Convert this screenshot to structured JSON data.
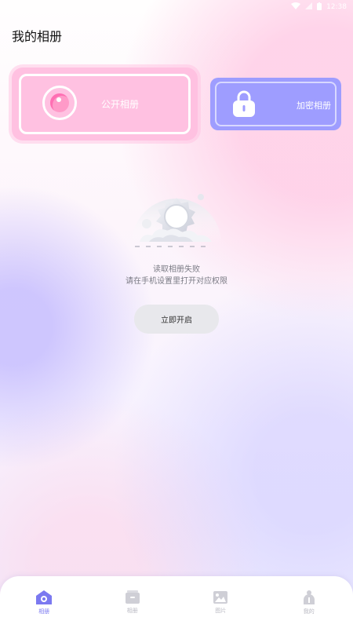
{
  "status_bar": {
    "time": "12:38",
    "icons": [
      "wifi-icon",
      "signal-icon",
      "battery-icon"
    ]
  },
  "header": {
    "title": "我的相册"
  },
  "cards": {
    "public": {
      "label": "公开相册",
      "icon": "eye-icon",
      "color": "#ffc1e1"
    },
    "encrypted": {
      "label": "加密相册",
      "icon": "lock-icon",
      "color": "#9e9dff"
    }
  },
  "empty_state": {
    "illustration": "empty-cloud-sun-illustration",
    "line1": "读取相册失败",
    "line2": "请在手机设置里打开对应权限",
    "button_label": "立即开启"
  },
  "tab_bar": {
    "active_color": "#7b79f0",
    "tabs": [
      {
        "label": "相册",
        "icon": "home-album-icon",
        "active": true
      },
      {
        "label": "相册",
        "icon": "album-box-icon",
        "active": false
      },
      {
        "label": "图片",
        "icon": "image-icon",
        "active": false
      },
      {
        "label": "我的",
        "icon": "profile-icon",
        "active": false
      }
    ]
  }
}
